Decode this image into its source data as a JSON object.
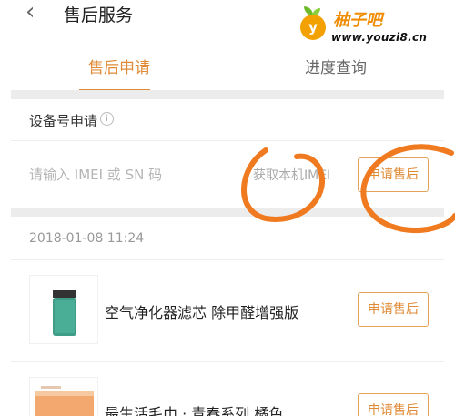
{
  "header": {
    "back_icon": "chevron-left-icon",
    "title": "售后服务"
  },
  "watermark": {
    "badge_letter": "y",
    "brand": "柚子吧",
    "url": "www.youzi8.cn"
  },
  "tabs": [
    {
      "label": "售后申请",
      "active": true
    },
    {
      "label": "进度查询",
      "active": false
    }
  ],
  "device_section": {
    "label": "设备号申请",
    "info_icon": "info-circle-icon",
    "input_placeholder": "请输入 IMEI 或 SN 码",
    "get_imei_label": "获取本机IMEI",
    "apply_label": "申请售后"
  },
  "order": {
    "date": "2018-01-08 11:24",
    "items": [
      {
        "name": "空气净化器滤芯 除甲醛增强版",
        "button": "申请售后"
      },
      {
        "name": "最生活毛巾 · 青春系列 橘色",
        "button": "申请售后"
      }
    ]
  },
  "colors": {
    "accent": "#e08a35",
    "annotation": "#f07a20"
  }
}
